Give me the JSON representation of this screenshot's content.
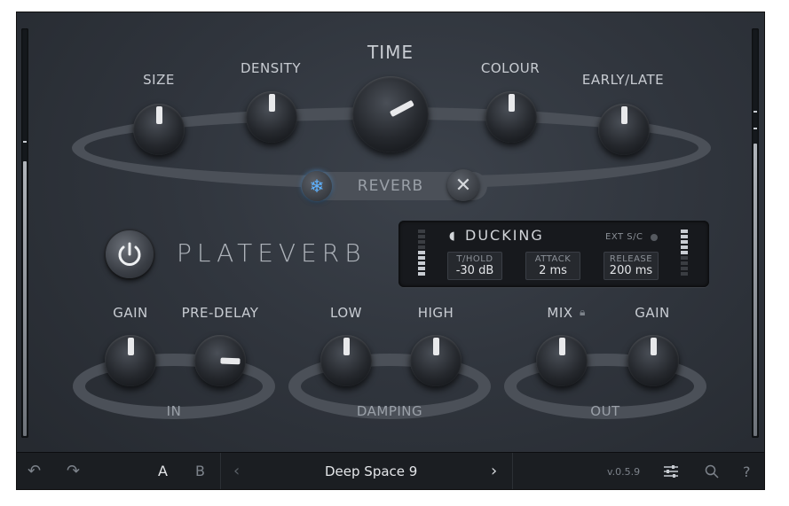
{
  "knobs": {
    "size": "SIZE",
    "density": "DENSITY",
    "time": "TIME",
    "colour": "COLOUR",
    "early_late": "EARLY/LATE",
    "gain_in": "GAIN",
    "pre_delay": "PRE-DELAY",
    "low": "LOW",
    "high": "HIGH",
    "mix": "MIX",
    "gain_out": "GAIN"
  },
  "reverb": {
    "label": "REVERB",
    "freeze_icon": "snowflake-icon",
    "kill_icon": "close-icon"
  },
  "brand": {
    "name": "PLATEVERB",
    "power_icon": "power-icon"
  },
  "ducking": {
    "title": "DUCKING",
    "duck_icon": "duck-icon",
    "ext_sc": "EXT S/C",
    "threshold_label": "T/HOLD",
    "threshold_value": "-30 dB",
    "attack_label": "ATTACK",
    "attack_value": "2 ms",
    "release_label": "RELEASE",
    "release_value": "200 ms"
  },
  "sections": {
    "in": "IN",
    "damping": "DAMPING",
    "out": "OUT"
  },
  "footer": {
    "undo_icon": "undo-icon",
    "redo_icon": "redo-icon",
    "a": "A",
    "b": "B",
    "prev_icon": "chevron-left-icon",
    "preset": "Deep Space 9",
    "next_icon": "chevron-right-icon",
    "version": "v.0.5.9",
    "settings_icon": "sliders-icon",
    "search_icon": "search-icon",
    "help": "?"
  },
  "colors": {
    "background": "#30353d",
    "knob_indicator": "#e8e9eb",
    "freeze_accent": "#5fb2ff"
  }
}
